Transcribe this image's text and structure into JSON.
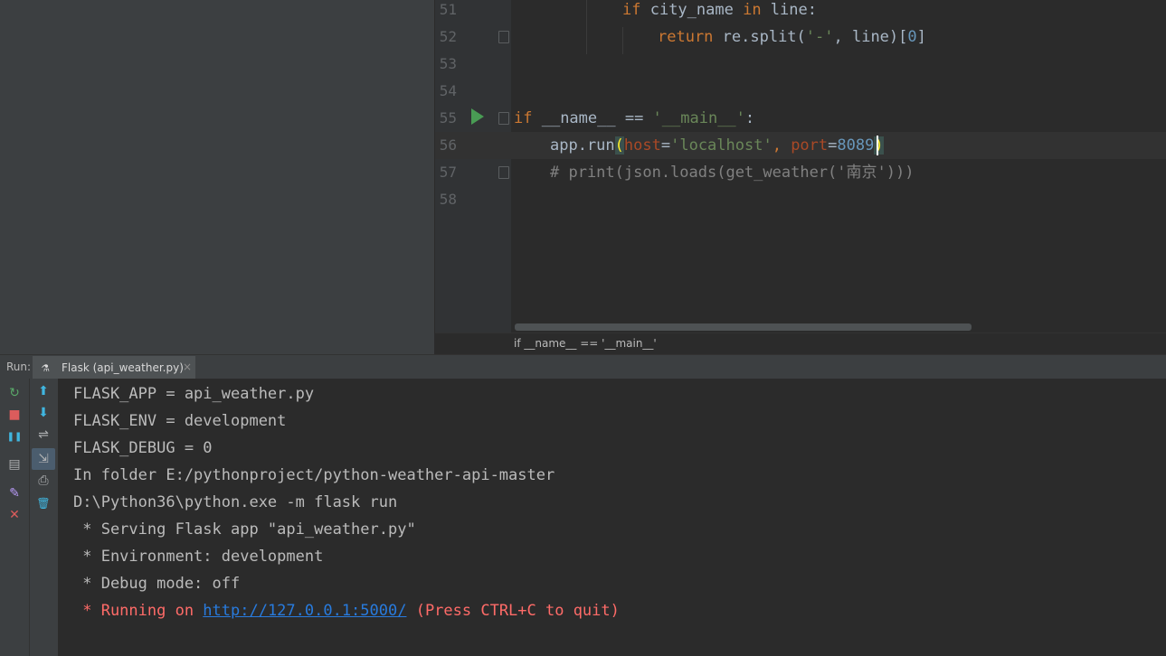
{
  "editor": {
    "lines": [
      {
        "num": "51"
      },
      {
        "num": "52"
      },
      {
        "num": "53"
      },
      {
        "num": "54"
      },
      {
        "num": "55"
      },
      {
        "num": "56"
      },
      {
        "num": "57"
      },
      {
        "num": "58"
      }
    ],
    "code": {
      "l51_kw1": "if",
      "l51_t1": " city_name ",
      "l51_kw2": "in",
      "l51_t2": " line:",
      "l52_kw": "return",
      "l52_t1": " re.split(",
      "l52_str": "'-'",
      "l52_t2": ", line)[",
      "l52_num": "0",
      "l52_t3": "]",
      "l55_kw": "if",
      "l55_t1": " __name__ == ",
      "l55_str": "'__main__'",
      "l55_t2": ":",
      "l56_t1": "app.run",
      "l56_open": "(",
      "l56_p1": "host",
      "l56_eq1": "=",
      "l56_str": "'localhost'",
      "l56_comma": ", ",
      "l56_p2": "port",
      "l56_eq2": "=",
      "l56_num": "8089",
      "l56_close": ")",
      "l57_cmt": "# print(json.loads(get_weather('南京')))"
    },
    "breadcrumb": "if __name__ == '__main__'"
  },
  "run_panel": {
    "label": "Run:",
    "tab_title": "Flask (api_weather.py)",
    "tab_close": "×",
    "tab_icon": "flask-config-icon"
  },
  "toolbar": {
    "rerun": "↻",
    "stop": "■",
    "pause": "❚❚",
    "dump": "▤",
    "pin": "✎",
    "close": "✕",
    "up": "⬆",
    "down": "⬇",
    "wrap": "⇌",
    "scroll_end": "⇲",
    "print": "⎙",
    "trash": "🗑"
  },
  "console": {
    "lines": [
      "FLASK_APP = api_weather.py",
      "FLASK_ENV = development",
      "FLASK_DEBUG = 0",
      "In folder E:/pythonproject/python-weather-api-master",
      "D:\\Python36\\python.exe -m flask run",
      " * Serving Flask app \"api_weather.py\"",
      " * Environment: development",
      " * Debug mode: off"
    ],
    "running_prefix": " * Running on ",
    "running_url": "http://127.0.0.1:5000/",
    "running_suffix": " (Press CTRL+C to quit)"
  },
  "colors": {
    "background": "#2b2b2b",
    "panel": "#3c3f41",
    "keyword": "#cc7832",
    "string": "#6a8759",
    "number": "#6897bb",
    "error": "#ff6b68",
    "link": "#287bde"
  }
}
